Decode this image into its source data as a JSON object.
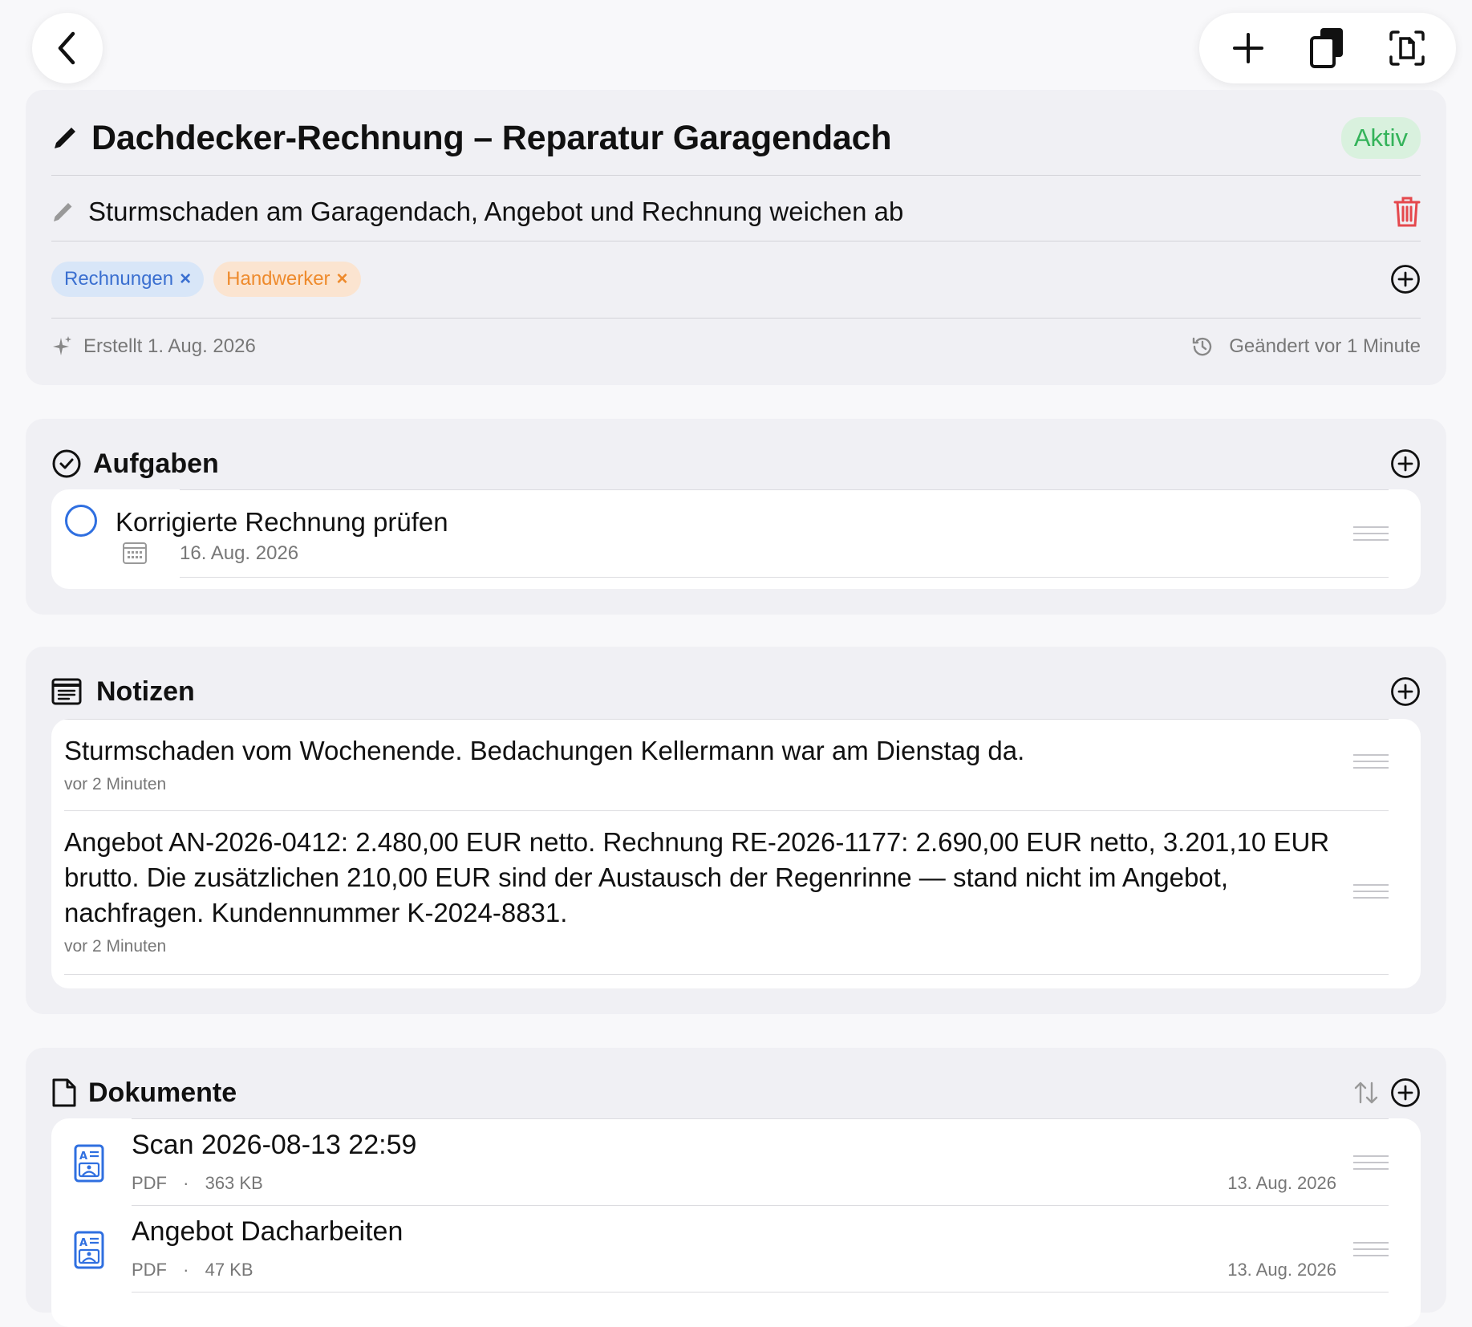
{
  "header": {
    "title": "Dachdecker-Rechnung – Reparatur Garagendach",
    "status": "Aktiv",
    "subtitle": "Sturmschaden am Garagendach, Angebot und Rechnung weichen ab",
    "tags": [
      {
        "label": "Rechnungen",
        "remove": "×"
      },
      {
        "label": "Handwerker",
        "remove": "×"
      }
    ],
    "created": "Erstellt 1. Aug. 2026",
    "modified": "Geändert vor 1 Minute"
  },
  "tasks": {
    "title": "Aufgaben",
    "items": [
      {
        "label": "Korrigierte Rechnung prüfen",
        "due": "16. Aug. 2026"
      }
    ]
  },
  "notes": {
    "title": "Notizen",
    "items": [
      {
        "text": "Sturmschaden vom Wochenende. Bedachungen Kellermann war am Dienstag da.",
        "time": "vor 2 Minuten"
      },
      {
        "text": "Angebot AN-2026-0412: 2.480,00 EUR netto. Rechnung RE-2026-1177: 2.690,00 EUR netto, 3.201,10 EUR brutto. Die zusätzlichen 210,00 EUR sind der Austausch der Regenrinne — stand nicht im Angebot, nachfragen. Kundennummer K-2024-8831.",
        "time": "vor 2 Minuten"
      }
    ]
  },
  "documents": {
    "title": "Dokumente",
    "items": [
      {
        "title": "Scan 2026-08-13 22:59",
        "type": "PDF",
        "sep": "·",
        "size": "363 KB",
        "date": "13. Aug. 2026"
      },
      {
        "title": "Angebot Dacharbeiten",
        "type": "PDF",
        "sep": "·",
        "size": "47 KB",
        "date": "13. Aug. 2026"
      }
    ]
  },
  "colors": {
    "accent": "#2f6fe0",
    "status_green": "#34b35a",
    "delete_red": "#e5484d"
  },
  "icons": [
    "back-chevron-icon",
    "plus-icon",
    "copy-icon",
    "scan-document-icon",
    "pencil-icon",
    "trash-icon",
    "plus-circle-icon",
    "sparkle-icon",
    "history-icon",
    "checkmark-circle-icon",
    "calendar-icon",
    "note-icon",
    "document-icon",
    "sort-icon",
    "pdf-document-icon",
    "drag-handle-icon"
  ]
}
